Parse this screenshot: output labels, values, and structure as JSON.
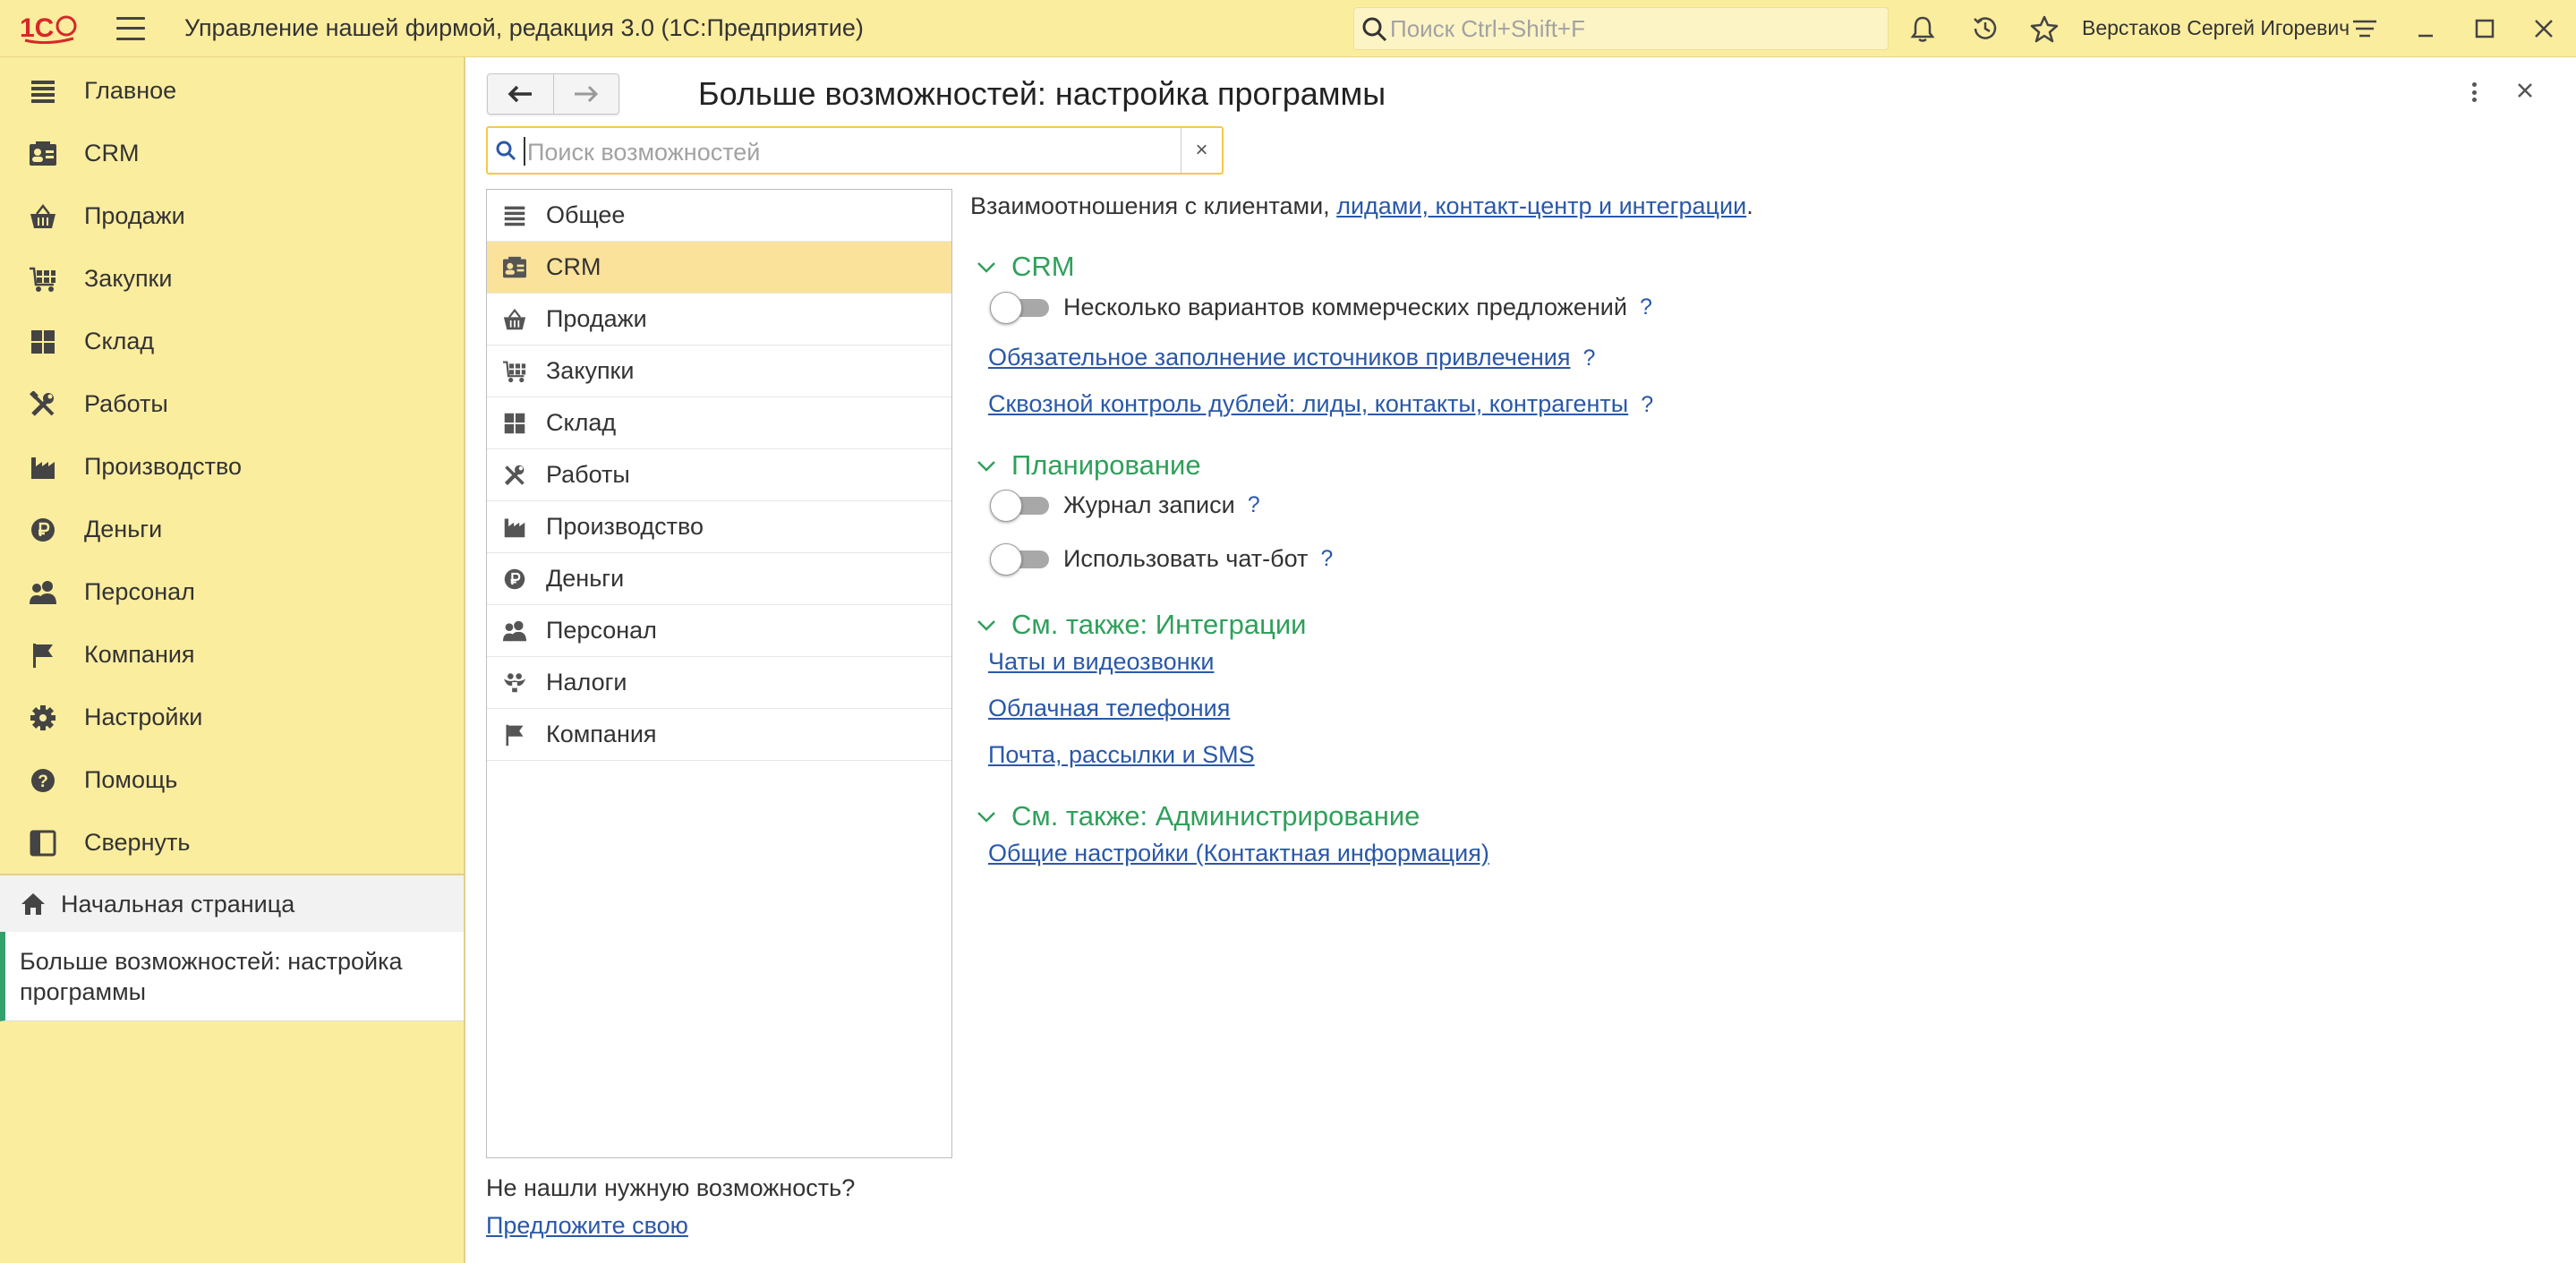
{
  "app": {
    "title": "Управление нашей фирмой, редакция 3.0  (1С:Предприятие)",
    "search_placeholder": "Поиск Ctrl+Shift+F",
    "user": "Верстаков Сергей Игоревич"
  },
  "sidebar": {
    "items": [
      {
        "label": "Главное",
        "icon": "list-icon"
      },
      {
        "label": "CRM",
        "icon": "contact-card-icon"
      },
      {
        "label": "Продажи",
        "icon": "basket-icon"
      },
      {
        "label": "Закупки",
        "icon": "cart-icon"
      },
      {
        "label": "Склад",
        "icon": "warehouse-icon"
      },
      {
        "label": "Работы",
        "icon": "tools-icon"
      },
      {
        "label": "Производство",
        "icon": "factory-icon"
      },
      {
        "label": "Деньги",
        "icon": "ruble-icon"
      },
      {
        "label": "Персонал",
        "icon": "people-icon"
      },
      {
        "label": "Компания",
        "icon": "flag-icon"
      },
      {
        "label": "Настройки",
        "icon": "gear-icon"
      },
      {
        "label": "Помощь",
        "icon": "help-icon"
      },
      {
        "label": "Свернуть",
        "icon": "collapse-panel-icon"
      }
    ],
    "home": "Начальная страница",
    "open_tab": "Больше возможностей: настройка программы"
  },
  "page": {
    "title": "Больше возможностей: настройка программы",
    "search_placeholder": "Поиск возможностей",
    "clear": "×",
    "categories": [
      {
        "label": "Общее",
        "icon": "list-icon"
      },
      {
        "label": "CRM",
        "icon": "contact-card-icon",
        "active": true
      },
      {
        "label": "Продажи",
        "icon": "basket-icon"
      },
      {
        "label": "Закупки",
        "icon": "cart-icon"
      },
      {
        "label": "Склад",
        "icon": "warehouse-icon"
      },
      {
        "label": "Работы",
        "icon": "tools-icon"
      },
      {
        "label": "Производство",
        "icon": "factory-icon"
      },
      {
        "label": "Деньги",
        "icon": "ruble-icon"
      },
      {
        "label": "Персонал",
        "icon": "people-icon"
      },
      {
        "label": "Налоги",
        "icon": "eagle-icon"
      },
      {
        "label": "Компания",
        "icon": "flag-icon"
      }
    ],
    "not_found": "Не нашли нужную возможность?",
    "suggest": "Предложите свою"
  },
  "settings": {
    "intro_text": "Взаимоотношения с клиентами, ",
    "intro_link": "лидами, контакт-центр и интеграции",
    "intro_end": ".",
    "help": "?",
    "crm": {
      "title": "CRM",
      "toggle_label": "Несколько вариантов коммерческих предложений",
      "toggle_on": false,
      "link1": "Обязательное заполнение источников привлечения",
      "link2": "Сквозной контроль дублей: лиды, контакты, контрагенты"
    },
    "planning": {
      "title": "Планирование",
      "toggle1": "Журнал записи",
      "toggle2": "Использовать чат-бот"
    },
    "integrations": {
      "title": "См. также: Интеграции",
      "links": [
        "Чаты и видеозвонки",
        "Облачная телефония",
        "Почта, рассылки и SMS"
      ]
    },
    "admin": {
      "title": "См. также: Администрирование",
      "link": "Общие настройки (Контактная информация)"
    }
  },
  "colors": {
    "accent_yellow": "#fbed9e",
    "active_item": "#fbe29b",
    "section_green": "#2fa05b",
    "link_blue": "#2a58a8"
  }
}
